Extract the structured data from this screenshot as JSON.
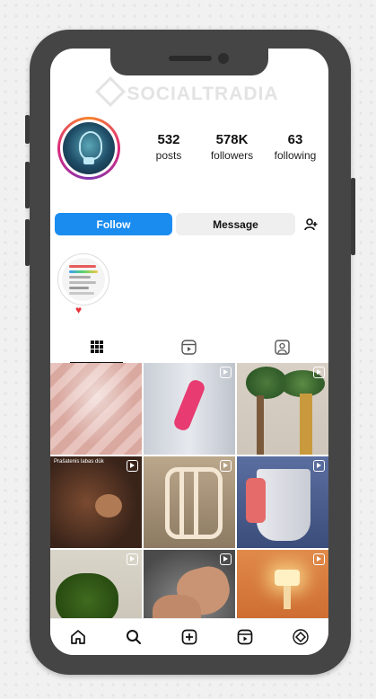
{
  "watermark": "SOCIALTRADIA",
  "profile": {
    "stats": [
      {
        "value": "532",
        "label": "posts"
      },
      {
        "value": "578K",
        "label": "followers"
      },
      {
        "value": "63",
        "label": "following"
      }
    ],
    "follow_label": "Follow",
    "message_label": "Message"
  },
  "highlights": [
    {
      "icon": "heart-icon"
    }
  ],
  "tabs": [
    {
      "icon": "grid-icon",
      "active": true
    },
    {
      "icon": "reels-icon",
      "active": false
    },
    {
      "icon": "tagged-icon",
      "active": false
    }
  ],
  "grid": {
    "posts": [
      {
        "caption": ""
      },
      {
        "caption": ""
      },
      {
        "caption": ""
      },
      {
        "caption": "Prašatenis labas dūk"
      },
      {
        "caption": ""
      },
      {
        "caption": ""
      },
      {
        "caption": ""
      },
      {
        "caption": ""
      },
      {
        "caption": ""
      }
    ]
  },
  "bottom_nav": [
    "home-icon",
    "search-icon",
    "create-icon",
    "reels-icon",
    "profile-icon"
  ],
  "colors": {
    "accent": "#1a8cf0",
    "heart": "#e6333a",
    "frame": "#454545"
  }
}
